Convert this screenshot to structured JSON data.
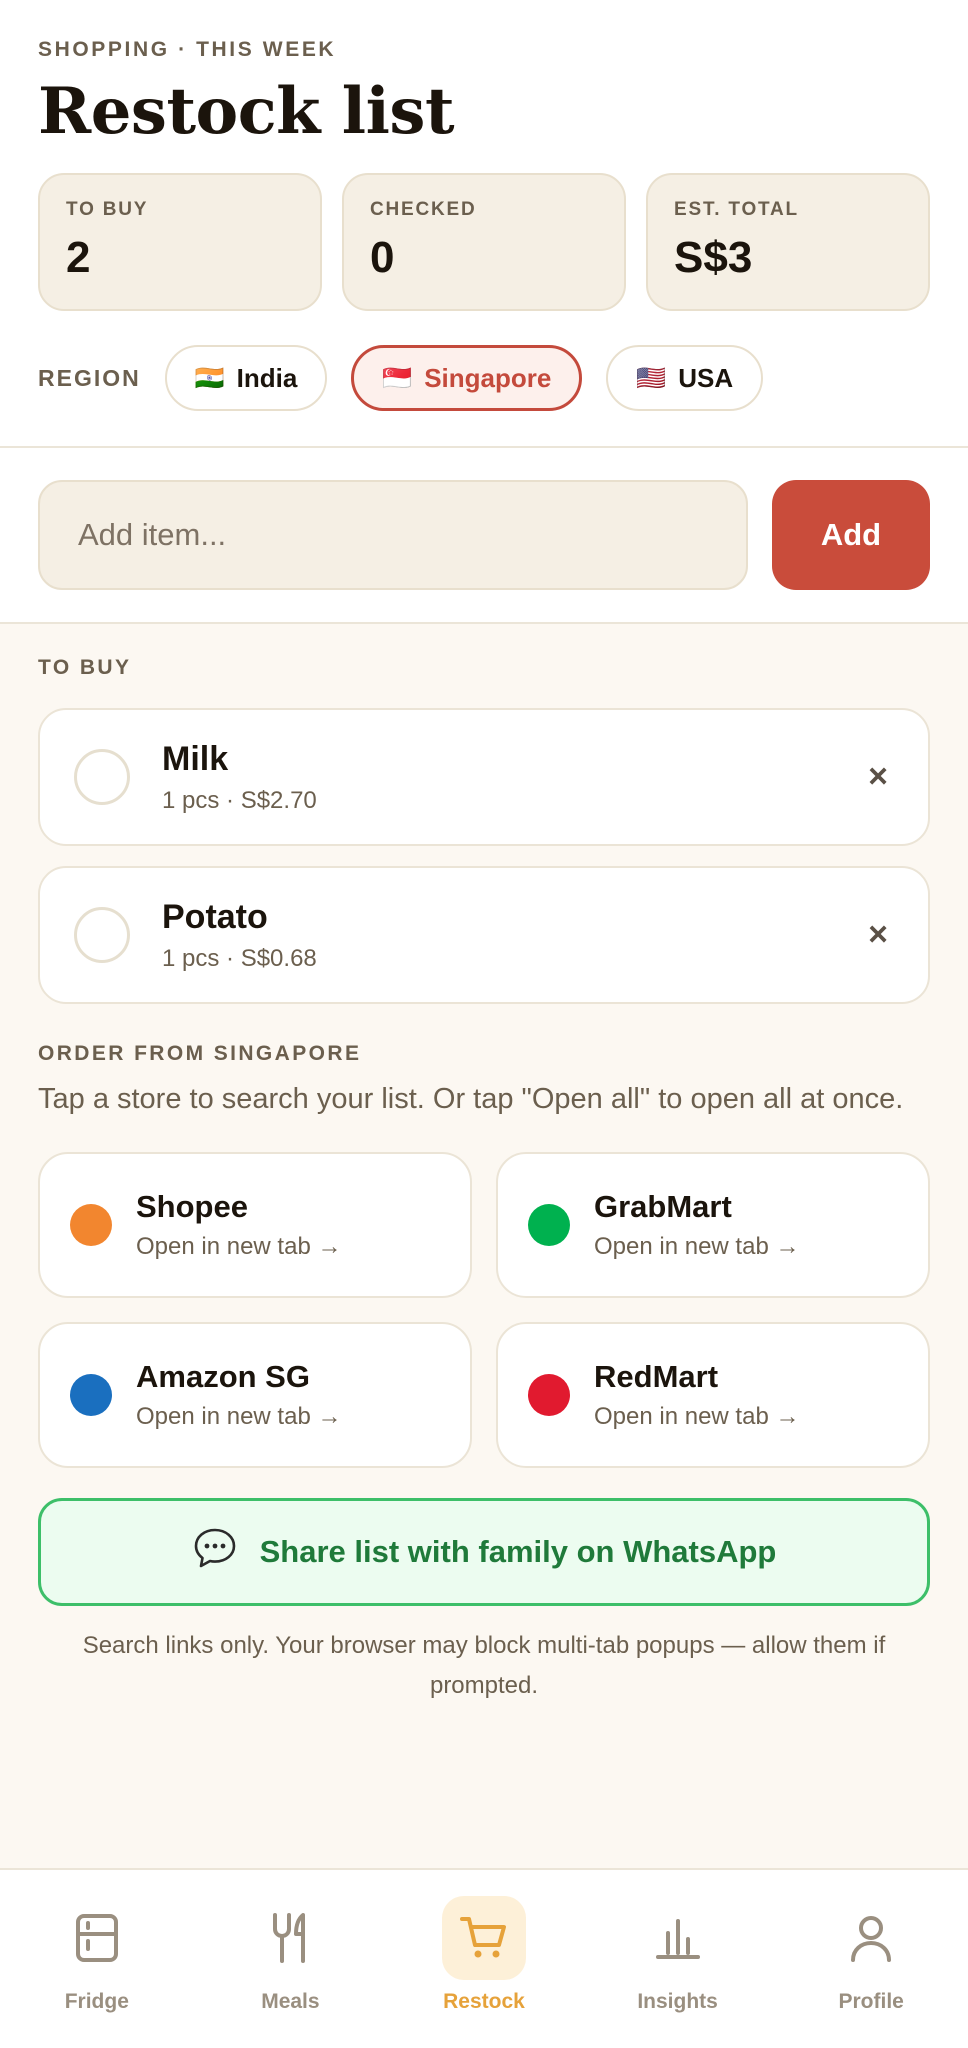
{
  "header": {
    "eyebrow": "SHOPPING · THIS WEEK",
    "title": "Restock list"
  },
  "stats": [
    {
      "label": "TO BUY",
      "value": "2"
    },
    {
      "label": "CHECKED",
      "value": "0"
    },
    {
      "label": "EST. TOTAL",
      "value": "S$3"
    }
  ],
  "region": {
    "label": "REGION",
    "options": [
      {
        "flag": "🇮🇳",
        "name": "India"
      },
      {
        "flag": "🇸🇬",
        "name": "Singapore"
      },
      {
        "flag": "🇺🇸",
        "name": "USA"
      }
    ],
    "selected": "Singapore"
  },
  "add": {
    "placeholder": "Add item...",
    "button_label": "Add"
  },
  "to_buy": {
    "label": "TO BUY",
    "items": [
      {
        "name": "Milk",
        "meta": "1 pcs · S$2.70"
      },
      {
        "name": "Potato",
        "meta": "1 pcs · S$0.68"
      }
    ],
    "remove_glyph": "×"
  },
  "order": {
    "label": "ORDER FROM SINGAPORE",
    "description": "Tap a store to search your list. Or tap \"Open all\" to open all at once.",
    "stores": [
      {
        "name": "Shopee",
        "sub": "Open in new tab →",
        "color": "#f2862f"
      },
      {
        "name": "GrabMart",
        "sub": "Open in new tab →",
        "color": "#00b14f"
      },
      {
        "name": "Amazon SG",
        "sub": "Open in new tab →",
        "color": "#1a6fbf"
      },
      {
        "name": "RedMart",
        "sub": "Open in new tab →",
        "color": "#e11a2f"
      }
    ]
  },
  "share": {
    "label": "Share list with family on WhatsApp",
    "icon": "speech-bubble-icon"
  },
  "note": "Search links only. Your browser may block multi-tab popups — allow them if prompted.",
  "tabs": [
    {
      "label": "Fridge",
      "icon": "fridge-icon"
    },
    {
      "label": "Meals",
      "icon": "fork-knife-icon"
    },
    {
      "label": "Restock",
      "icon": "cart-icon",
      "active": true
    },
    {
      "label": "Insights",
      "icon": "bar-chart-icon"
    },
    {
      "label": "Profile",
      "icon": "person-icon"
    }
  ],
  "colors": {
    "accent": "#c94c3b",
    "tab_active": "#e6a23a",
    "whatsapp_green": "#1f7a3a"
  }
}
